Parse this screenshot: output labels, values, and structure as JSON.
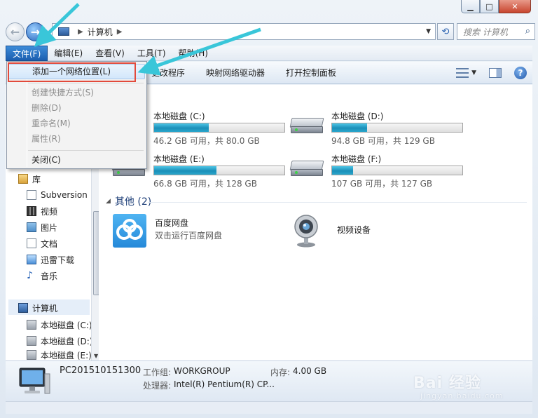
{
  "address": {
    "path": "计算机",
    "search_placeholder": "搜索 计算机"
  },
  "menubar": {
    "items": [
      "文件(F)",
      "编辑(E)",
      "查看(V)",
      "工具(T)",
      "帮助(H)"
    ]
  },
  "toolbar": {
    "commands": [
      "更改程序",
      "映射网络驱动器",
      "打开控制面板"
    ]
  },
  "file_menu": {
    "items": [
      {
        "label": "添加一个网络位置(L)",
        "state": "highlighted"
      },
      {
        "label": "创建快捷方式(S)",
        "state": "disabled"
      },
      {
        "label": "删除(D)",
        "state": "disabled"
      },
      {
        "label": "重命名(M)",
        "state": "disabled"
      },
      {
        "label": "属性(R)",
        "state": "disabled"
      },
      {
        "label": "关闭(C)",
        "state": "enabled"
      }
    ]
  },
  "nav_pane": {
    "libraries": [
      "库",
      "Subversion",
      "视频",
      "图片",
      "文档",
      "迅雷下载",
      "音乐"
    ],
    "computer": [
      "计算机",
      "本地磁盘 (C:)",
      "本地磁盘 (D:)",
      "本地磁盘 (E:)"
    ]
  },
  "drives_group": {
    "header_tail": ")"
  },
  "drives": [
    {
      "name": "本地磁盘 (C:)",
      "free_text": "46.2 GB 可用，共 80.0 GB",
      "used_fraction": 0.42
    },
    {
      "name": "本地磁盘 (D:)",
      "free_text": "94.8 GB 可用，共 129 GB",
      "used_fraction": 0.27
    },
    {
      "name": "本地磁盘 (E:)",
      "free_text": "66.8 GB 可用，共 128 GB",
      "used_fraction": 0.48
    },
    {
      "name": "本地磁盘 (F:)",
      "free_text": "107 GB 可用，共 127 GB",
      "used_fraction": 0.16
    }
  ],
  "other_group": {
    "header": "其他 (2)",
    "items": [
      {
        "name": "百度网盘",
        "sub": "双击运行百度网盘"
      },
      {
        "name": "视频设备",
        "sub": ""
      }
    ]
  },
  "details": {
    "pc_name": "PC201510151300",
    "workgroup_label": "工作组:",
    "workgroup": "WORKGROUP",
    "memory_label": "内存:",
    "memory": "4.00 GB",
    "cpu_label": "处理器:",
    "cpu": "Intel(R) Pentium(R) CP..."
  },
  "watermark": {
    "text": "Bai 经验",
    "sub": "jingyan.baidu.com"
  },
  "colors": {
    "annotation_arrow": "#39c6d9",
    "annotation_box": "#e24a3b",
    "drive_bar": "#1b8fb8",
    "menu_active": "#1c5fb0"
  }
}
